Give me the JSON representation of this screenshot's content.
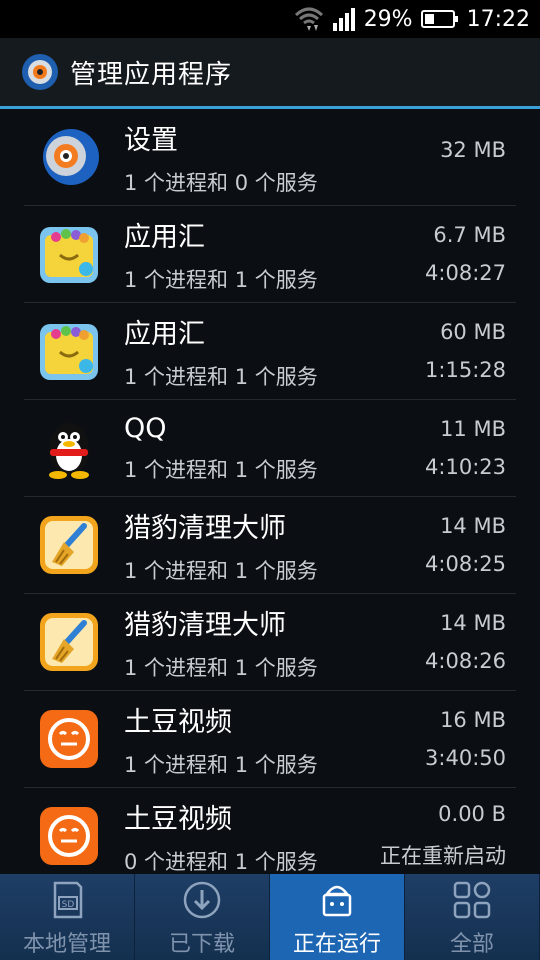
{
  "status_bar": {
    "battery": "29%",
    "time": "17:22"
  },
  "header": {
    "title": "管理应用程序"
  },
  "apps": [
    {
      "name": "设置",
      "procs": "1 个进程和 0 个服务",
      "size": "32 MB",
      "time": "",
      "icon": "settings-gear-icon"
    },
    {
      "name": "应用汇",
      "procs": "1 个进程和 1 个服务",
      "size": "6.7 MB",
      "time": "4:08:27",
      "icon": "app-store-basket-icon"
    },
    {
      "name": "应用汇",
      "procs": "1 个进程和 1 个服务",
      "size": "60 MB",
      "time": "1:15:28",
      "icon": "app-store-basket-icon"
    },
    {
      "name": "QQ",
      "procs": "1 个进程和 1 个服务",
      "size": "11 MB",
      "time": "4:10:23",
      "icon": "qq-penguin-icon"
    },
    {
      "name": "猎豹清理大师",
      "procs": "1 个进程和 1 个服务",
      "size": "14 MB",
      "time": "4:08:25",
      "icon": "broom-icon"
    },
    {
      "name": "猎豹清理大师",
      "procs": "1 个进程和 1 个服务",
      "size": "14 MB",
      "time": "4:08:26",
      "icon": "broom-icon"
    },
    {
      "name": "土豆视频",
      "procs": "1 个进程和 1 个服务",
      "size": "16 MB",
      "time": "3:40:50",
      "icon": "tudou-face-icon"
    },
    {
      "name": "土豆视频",
      "procs": "0 个进程和 1 个服务",
      "size": "0.00 B",
      "time": "正在重新启动",
      "icon": "tudou-face-icon"
    }
  ],
  "tabs": [
    {
      "label": "本地管理",
      "icon": "sd-card-icon",
      "active": false
    },
    {
      "label": "已下载",
      "icon": "download-icon",
      "active": false
    },
    {
      "label": "正在运行",
      "icon": "running-android-icon",
      "active": true
    },
    {
      "label": "全部",
      "icon": "grid-apps-icon",
      "active": false
    }
  ]
}
